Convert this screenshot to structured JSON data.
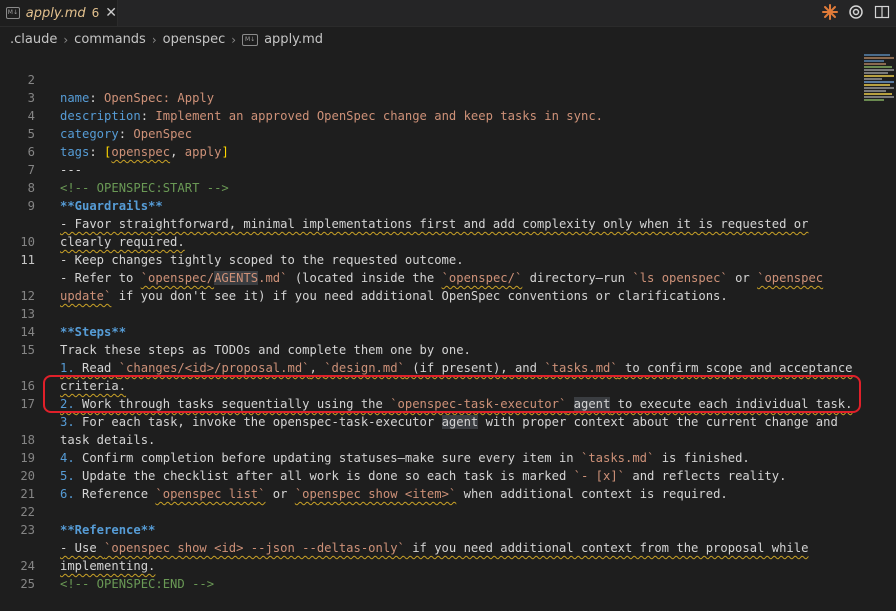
{
  "tab": {
    "title": "apply.md",
    "problems": "6",
    "close_glyph": "✕",
    "badge": "M↓"
  },
  "breadcrumb": {
    "items": [
      ".claude",
      "commands",
      "openspec",
      "apply.md"
    ],
    "separator": "›"
  },
  "top_icons": [
    "sparkle-icon",
    "openai-icon",
    "split-editor-icon"
  ],
  "line_numbers": [
    "2",
    "3",
    "4",
    "5",
    "6",
    "7",
    "8",
    "9",
    "",
    "10",
    "11",
    "",
    "12",
    "13",
    "14",
    "15",
    "",
    "16",
    "17",
    "",
    "18",
    "19",
    "20",
    "21",
    "22",
    "23",
    "",
    "24",
    "25"
  ],
  "current_line": "11",
  "code": {
    "l2_key": "name",
    "l2_val": "OpenSpec: Apply",
    "l3_key": "description",
    "l3_val": "Implement an approved OpenSpec change and keep tasks in sync.",
    "l4_key": "category",
    "l4_val": "OpenSpec",
    "l5_key": "tags",
    "l5_open": "[",
    "l5_t1": "openspec",
    "l5_comma": ", ",
    "l5_t2": "apply",
    "l5_close": "]",
    "l6": "---",
    "l7": "<!-- OPENSPEC:START -->",
    "l8": "**Guardrails**",
    "l9a": "- Favor straightforward, minimal implementations first and add complexity only when it is requested or",
    "l9b": "clearly required.",
    "l10": "- Keep changes tightly scoped to the requested outcome.",
    "l11a_1": "- Refer to ",
    "l11a_2": "`openspec/",
    "l11a_3": "AGENTS",
    "l11a_4": ".md`",
    "l11a_5": " (located inside the ",
    "l11a_6": "`openspec/`",
    "l11a_7": " directory—run ",
    "l11a_8": "`ls openspec`",
    "l11a_9": " or ",
    "l11a_10": "`openspec",
    "l11b_1": "update`",
    "l11b_2": " if you don't see it) if you need additional OpenSpec conventions or clarifications.",
    "l13": "**Steps**",
    "l14": "Track these steps as TODOs and complete them one by one.",
    "l15a_n": "1.",
    "l15a_1": " Read ",
    "l15a_2": "`changes/<id>/proposal.md`",
    "l15a_3": ", ",
    "l15a_4": "`design.md`",
    "l15a_5": " (if present), and ",
    "l15a_6": "`tasks.md`",
    "l15a_7": " to confirm scope and acceptance",
    "l15b": "criteria.",
    "l16_n": "2.",
    "l16_1": " Work through tasks sequentially using the ",
    "l16_2": "`openspec-task-executor`",
    "l16_3": " ",
    "l16_4": "agent",
    "l16_5": " to execute each individual task.",
    "l17a_n": "3.",
    "l17a_1": " For each task, invoke the openspec-task-executor ",
    "l17a_2": "agent",
    "l17a_3": " with proper context about the current change and",
    "l17b": "task details.",
    "l18_n": "4.",
    "l18_1": " Confirm completion before updating statuses—make sure every item in ",
    "l18_2": "`tasks.md`",
    "l18_3": " is finished.",
    "l19_n": "5.",
    "l19_1": " Update the checklist after all work is done so each task is marked ",
    "l19_2": "`- [x]`",
    "l19_3": " and reflects reality.",
    "l20_n": "6.",
    "l20_1": " Reference ",
    "l20_2": "`openspec list`",
    "l20_3": " or ",
    "l20_4": "`openspec show <item>`",
    "l20_5": " when additional context is required.",
    "l22": "**Reference**",
    "l23a_1": "- Use ",
    "l23a_2": "`openspec show <id> --json --deltas-only`",
    "l23a_3": " if you need additional context from the proposal while",
    "l23b": "implementing.",
    "l24": "<!-- OPENSPEC:END -->"
  },
  "colors": {
    "highlight_box": "#e0202a",
    "key": "#569cd6",
    "string": "#ce9178",
    "comment": "#6a9955"
  }
}
